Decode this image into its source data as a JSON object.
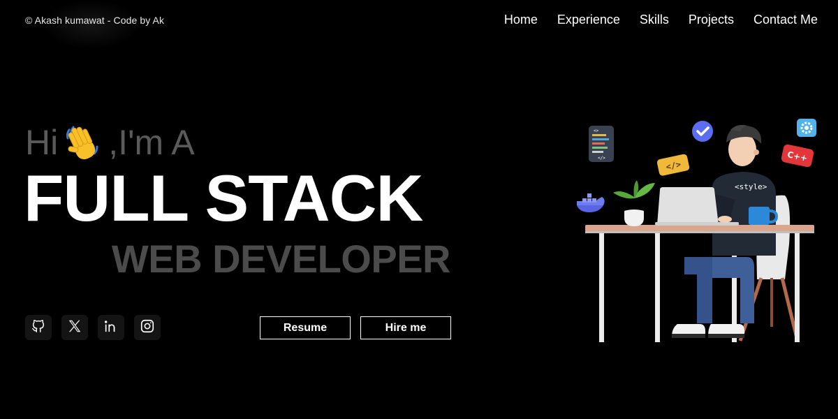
{
  "header": {
    "brand": "© Akash kumawat - Code by Ak",
    "nav": [
      "Home",
      "Experience",
      "Skills",
      "Projects",
      "Contact Me"
    ]
  },
  "hero": {
    "greeting_prefix": "Hi",
    "greeting_suffix": ",I'm A",
    "title_line1": "FULL STACK",
    "title_line2": "WEB DEVELOPER"
  },
  "socials": [
    {
      "icon": "github-icon"
    },
    {
      "icon": "x-twitter-icon"
    },
    {
      "icon": "linkedin-icon"
    },
    {
      "icon": "instagram-icon"
    }
  ],
  "buttons": {
    "resume": "Resume",
    "hire": "Hire me"
  },
  "illustration": {
    "hoodie_text": "<style>",
    "code_badge": "</>",
    "cpp_badge": "C++"
  },
  "colors": {
    "background": "#000000",
    "text": "#ffffff",
    "muted_text": "#5a5a5a",
    "social_bg": "#141414"
  }
}
